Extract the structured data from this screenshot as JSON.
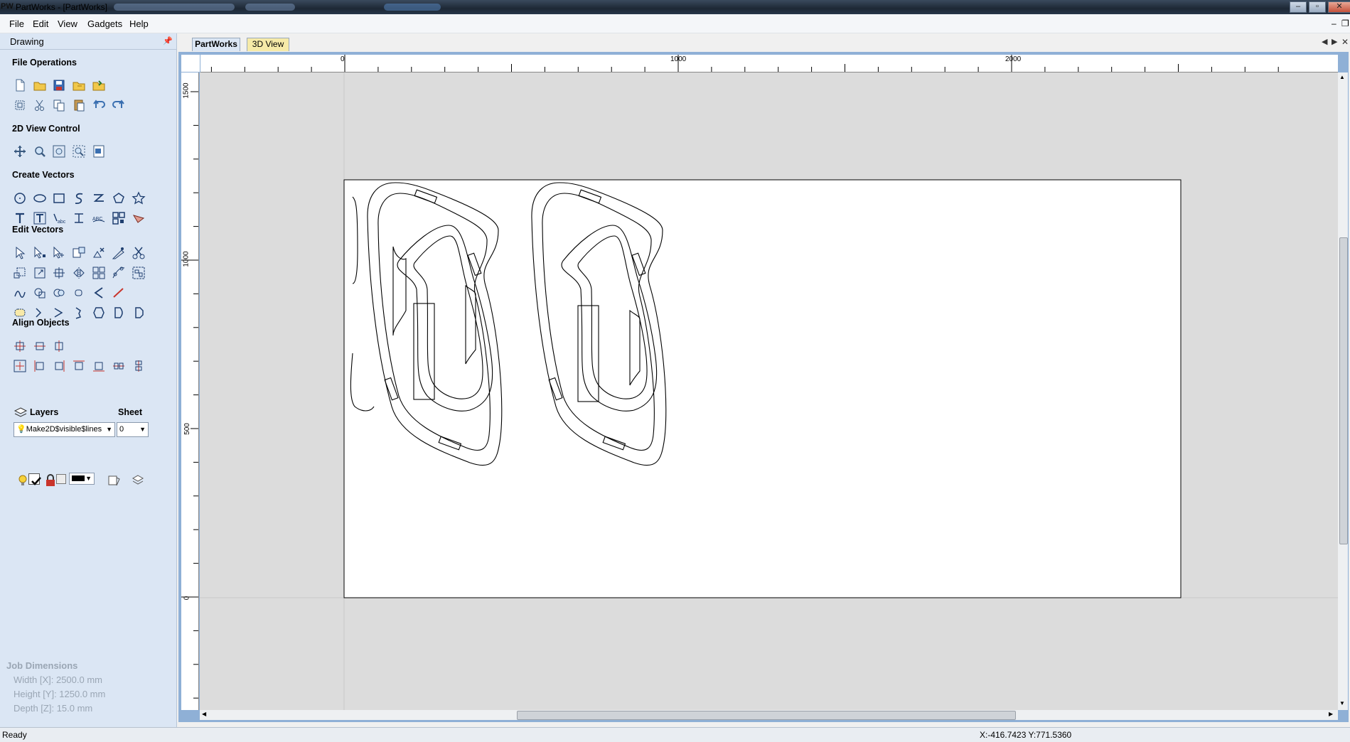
{
  "window": {
    "title": "PartWorks - [PartWorks]",
    "logo": "PW"
  },
  "menu": {
    "file": "File",
    "edit": "Edit",
    "view": "View",
    "gadgets": "Gadgets",
    "help": "Help"
  },
  "panel": {
    "title": "Drawing",
    "sections": {
      "file_operations": "File Operations",
      "view_control": "2D View Control",
      "create_vectors": "Create Vectors",
      "edit_vectors": "Edit Vectors",
      "align_objects": "Align Objects"
    },
    "layers_label": "Layers",
    "sheet_label": "Sheet",
    "layer_value": "Make2D$visible$lines",
    "sheet_value": "0"
  },
  "job_dimensions": {
    "heading": "Job Dimensions",
    "width": "Width  [X]: 2500.0 mm",
    "height": "Height [Y]: 1250.0 mm",
    "depth": "Depth  [Z]: 15.0 mm"
  },
  "tabs": [
    {
      "label": "PartWorks",
      "active": true
    },
    {
      "label": "3D View",
      "active": false
    }
  ],
  "ruler": {
    "h_labels": [
      "0",
      "1000",
      "2000"
    ],
    "v_labels": [
      "1500",
      "1000",
      "500",
      "0"
    ]
  },
  "status": {
    "left": "Ready",
    "coords": "X:-416.7423 Y:771.5360"
  },
  "colors": {
    "panel_bg": "#dbe6f4",
    "canvas_bg": "#dcdcdc",
    "sheet_bg": "#ffffff",
    "tab_active": "#dbe6f4",
    "tab_inactive": "#f6eaa8",
    "frame": "#8fb0d6"
  }
}
